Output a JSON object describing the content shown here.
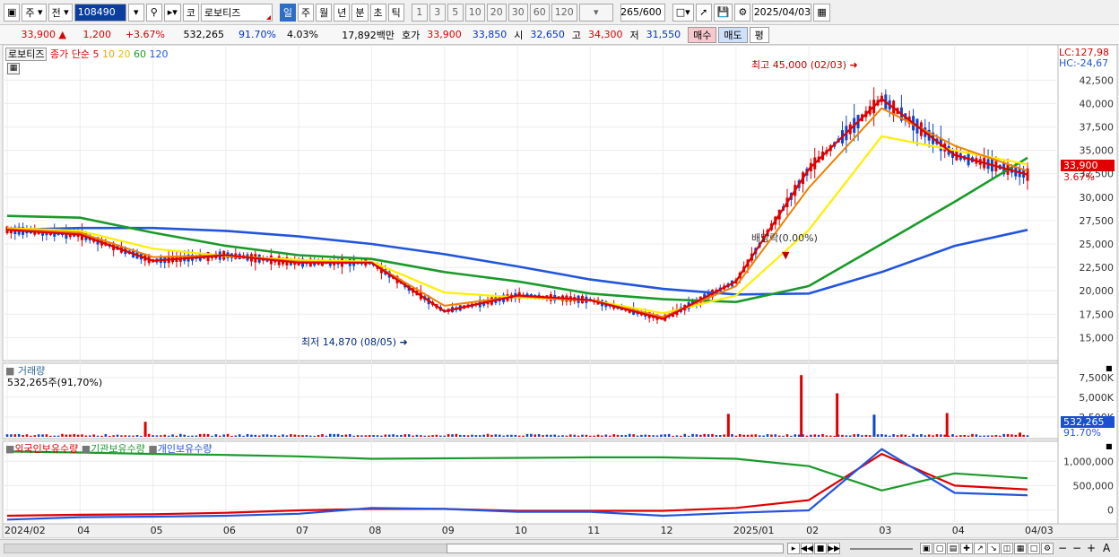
{
  "toolbar": {
    "market_type": "주",
    "prev_label": "전",
    "stock_code": "108490",
    "stock_name_prefix": "코",
    "stock_name": "로보티즈",
    "periods": [
      "일",
      "주",
      "월",
      "년",
      "분",
      "초",
      "틱"
    ],
    "selected_period": "일",
    "intervals": [
      "1",
      "3",
      "5",
      "10",
      "20",
      "30",
      "60",
      "120"
    ],
    "count": "265",
    "count_total": "/600",
    "date": "2025/04/03"
  },
  "quote": {
    "price": "33,900",
    "change": "1,200",
    "change_pct": "+3.67%",
    "volume": "532,265",
    "vol_ratio": "91.70%",
    "turnover": "4.03%",
    "amount": "17,892백만",
    "ask_label": "호가",
    "ask1": "33,900",
    "ask2": "33,850",
    "low_label": "시",
    "open": "32,650",
    "high_label": "고",
    "high": "34,300",
    "low_label2": "저",
    "low": "31,550",
    "buy": "매수",
    "sell": "매도",
    "avg": "평"
  },
  "legend": {
    "stock": "로보티즈",
    "ma_label": "종가 단순 5",
    "ma10": "10",
    "ma20": "20",
    "ma60": "60",
    "ma120": "120",
    "lc": "LC:127,98",
    "hc": "HC:-24,67",
    "volume_title": "거래량",
    "volume_value": "532,265주(91,70%)",
    "holdings": [
      "외국인보유수량",
      "기관보유수량",
      "개인보유수량"
    ]
  },
  "annotations": {
    "high": "최고 45,000 (02/03)",
    "low": "최저 14,870 (08/05)",
    "dividend": "배당락(0.00%)",
    "last_price": "33,900",
    "last_pct": "3.67%",
    "last_volume": "532,265",
    "last_vol_pct": "91.70%"
  },
  "colors": {
    "up": "#e00000",
    "down": "#1144cc",
    "ma5": "#e00000",
    "ma10": "#f08000",
    "ma20": "#ffee00",
    "ma60": "#1a9a2a",
    "ma120": "#2255dd"
  },
  "chart_data": [
    {
      "type": "line",
      "title": "로보티즈",
      "x_ticks": [
        "2024/02",
        "04",
        "05",
        "06",
        "07",
        "08",
        "09",
        "10",
        "11",
        "12",
        "2025/01",
        "02",
        "03",
        "04",
        "04/03"
      ],
      "y_ticks": [
        "15,000",
        "17,500",
        "20,000",
        "22,500",
        "25,000",
        "27,500",
        "30,000",
        "32,500",
        "35,000",
        "37,500",
        "40,000",
        "42,500"
      ],
      "ylim": [
        13500,
        45500
      ],
      "x": [
        "2024-02",
        "2024-03",
        "2024-04",
        "2024-05",
        "2024-06",
        "2024-07",
        "2024-08",
        "2024-09",
        "2024-10",
        "2024-11",
        "2024-12",
        "2025-01",
        "2025-02",
        "2025-03",
        "2025-04"
      ],
      "series": [
        {
          "name": "5",
          "values": [
            26500,
            26000,
            23200,
            23800,
            23000,
            23000,
            17800,
            19500,
            19000,
            17000,
            21000,
            33000,
            40500,
            34500,
            32400
          ]
        },
        {
          "name": "10",
          "values": [
            26600,
            26200,
            23600,
            23800,
            23100,
            23000,
            18400,
            19400,
            19000,
            17200,
            20500,
            31000,
            39500,
            35500,
            32800
          ]
        },
        {
          "name": "20",
          "values": [
            26700,
            26400,
            24500,
            23700,
            23300,
            23100,
            19800,
            19300,
            19000,
            17600,
            19500,
            26500,
            36500,
            35000,
            33500
          ]
        },
        {
          "name": "60",
          "values": [
            28000,
            27800,
            26200,
            24800,
            23800,
            23400,
            22000,
            21000,
            19700,
            19100,
            18800,
            20500,
            25000,
            29500,
            34200
          ]
        },
        {
          "name": "120",
          "values": [
            26500,
            26700,
            26700,
            26400,
            25800,
            25000,
            23900,
            22600,
            21200,
            20200,
            19600,
            19700,
            22000,
            24800,
            26500
          ]
        }
      ]
    },
    {
      "type": "bar",
      "title": "거래량",
      "y_ticks": [
        "2,500K",
        "5,000K",
        "7,500K"
      ],
      "ylim": [
        0,
        8500000
      ],
      "notable_bars": [
        {
          "x": "2024-04",
          "value": 1900000,
          "direction": "up"
        },
        {
          "x": "2024-12",
          "value": 2900000,
          "direction": "up"
        },
        {
          "x": "2025-01",
          "value": 7800000,
          "direction": "up"
        },
        {
          "x": "2025-01",
          "value": 5500000,
          "direction": "up"
        },
        {
          "x": "2025-02",
          "value": 2800000,
          "direction": "down"
        },
        {
          "x": "2025-03",
          "value": 3000000,
          "direction": "up"
        },
        {
          "x": "2025-04",
          "value": 532265,
          "direction": "up"
        }
      ]
    },
    {
      "type": "line",
      "title": "보유수량",
      "y_ticks": [
        "0",
        "500,000",
        "1,000,000"
      ],
      "ylim": [
        -250000,
        1300000
      ],
      "series": [
        {
          "name": "외국인보유수량",
          "values": [
            -120000,
            -100000,
            -90000,
            -60000,
            -10000,
            20000,
            20000,
            -20000,
            -20000,
            -20000,
            40000,
            200000,
            1150000,
            500000,
            420000
          ]
        },
        {
          "name": "기관보유수량",
          "values": [
            1200000,
            1180000,
            1150000,
            1130000,
            1100000,
            1050000,
            1060000,
            1070000,
            1080000,
            1080000,
            1050000,
            900000,
            400000,
            750000,
            650000
          ]
        },
        {
          "name": "개인보유수량",
          "values": [
            -200000,
            -150000,
            -140000,
            -120000,
            -80000,
            40000,
            20000,
            -40000,
            -40000,
            -120000,
            -60000,
            -10000,
            1250000,
            350000,
            300000
          ]
        }
      ]
    }
  ]
}
